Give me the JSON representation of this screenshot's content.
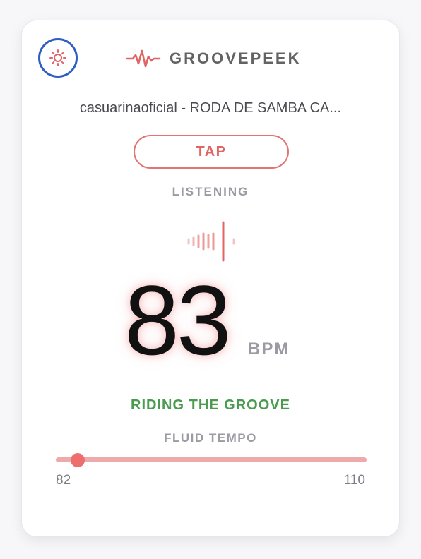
{
  "header": {
    "brand_name": "GROOVEPEEK",
    "theme_icon": "sun-icon",
    "brand_icon": "pulse-wave-icon"
  },
  "track": {
    "title": "casuarinaoficial - RODA DE SAMBA CA..."
  },
  "controls": {
    "tap_label": "TAP"
  },
  "status": {
    "label": "LISTENING",
    "icon": "audio-waveform-icon"
  },
  "tempo": {
    "bpm": "83",
    "unit": "BPM",
    "feel": "RIDING THE GROOVE",
    "mode": "FLUID TEMPO"
  },
  "range": {
    "min": "82",
    "max": "110",
    "current": 83
  },
  "colors": {
    "accent": "#e06565",
    "focus_ring": "#2d5fc4",
    "positive": "#4a9b4f",
    "muted": "#9a9ba3"
  }
}
